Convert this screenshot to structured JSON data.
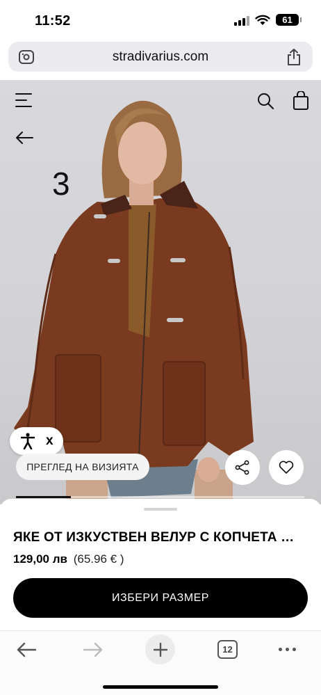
{
  "status_bar": {
    "time": "11:52",
    "battery": "61",
    "icons": [
      "signal-icon",
      "wifi-icon",
      "battery-icon"
    ]
  },
  "address_bar": {
    "url": "stradivarius.com",
    "left_icon": "page-settings-icon",
    "right_icon": "share-icon"
  },
  "hero": {
    "slide_number": "3",
    "icons": [
      "menu-icon",
      "search-icon",
      "shopping-bag-icon",
      "back-arrow-icon"
    ],
    "accessibility_close": "x",
    "preview_button": "ПРЕГЛЕД НА ВИЗИЯТА",
    "gallery_progress": 0.19,
    "colors": {
      "jacket": "#7a3a1f",
      "collar": "#4a2418",
      "backdrop": "#d6d6da"
    }
  },
  "product": {
    "title": "ЯКЕ ОТ ИЗКУСТВЕН ВЕЛУР С КОПЧЕТА МОНТГОМЪРИ",
    "price_main": "129,00 лв",
    "price_alt": "(65.96 € )",
    "select_size_label": "ИЗБЕРИ РАЗМЕР"
  },
  "browser_toolbar": {
    "tab_count": "12",
    "icons": [
      "back-icon",
      "forward-icon",
      "new-tab-icon",
      "tabs-icon",
      "more-icon"
    ]
  }
}
